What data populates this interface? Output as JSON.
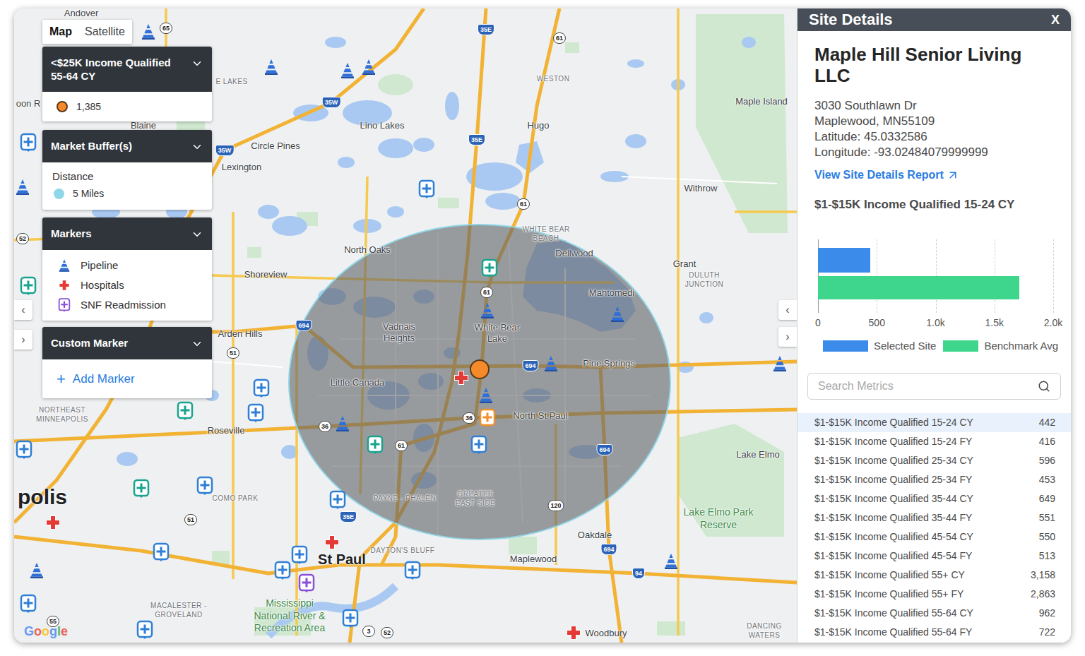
{
  "map_toggle": [
    {
      "label": "Map",
      "selected": true
    },
    {
      "label": "Satellite",
      "selected": false
    }
  ],
  "legend": {
    "metric_card": {
      "title": "<$25K Income Qualified 55-64 CY",
      "items": [
        {
          "value": "1,385",
          "color": "#f58a2b"
        }
      ]
    },
    "buffer_card": {
      "title": "Market Buffer(s)",
      "subtitle": "Distance",
      "items": [
        {
          "label": "5 Miles",
          "color": "#8fd6e6"
        }
      ]
    },
    "markers_card": {
      "title": "Markers",
      "items": [
        {
          "label": "Pipeline",
          "kind": "pipeline"
        },
        {
          "label": "Hospitals",
          "kind": "hospital"
        },
        {
          "label": "SNF Readmission",
          "kind": "snf",
          "color": "#8a4fd6"
        }
      ]
    },
    "custom_card": {
      "title": "Custom Marker",
      "action_icon": "+",
      "action": "Add Marker"
    }
  },
  "map": {
    "labels": [
      {
        "text": "Andover",
        "kind": "city"
      },
      {
        "text": "oon R",
        "kind": "city"
      },
      {
        "text": "Blaine",
        "kind": "city"
      },
      {
        "text": "E LAKES",
        "kind": "district"
      },
      {
        "text": "Lino Lakes",
        "kind": "city"
      },
      {
        "text": "Circle Pines",
        "kind": "city"
      },
      {
        "text": "Lexington",
        "kind": "city"
      },
      {
        "text": "WESTON",
        "kind": "district"
      },
      {
        "text": "Hugo",
        "kind": "city"
      },
      {
        "text": "Maple Island",
        "kind": "city"
      },
      {
        "text": "Withrow",
        "kind": "city"
      },
      {
        "text": "North Oaks",
        "kind": "city"
      },
      {
        "text": "WHITE BEAR BEACH",
        "kind": "district"
      },
      {
        "text": "Dellwood",
        "kind": "city"
      },
      {
        "text": "Grant",
        "kind": "city"
      },
      {
        "text": "DULUTH JUNCTION",
        "kind": "district"
      },
      {
        "text": "Mahtomedi",
        "kind": "city"
      },
      {
        "text": "Shoreview",
        "kind": "city"
      },
      {
        "text": "Vadnais Heights",
        "kind": "city"
      },
      {
        "text": "White Bear Lake",
        "kind": "city"
      },
      {
        "text": "Arden Hills",
        "kind": "city"
      },
      {
        "text": "Pine Springs",
        "kind": "city"
      },
      {
        "text": "Little Canada",
        "kind": "city"
      },
      {
        "text": "NORTHEAST MINNEAPOLIS",
        "kind": "district"
      },
      {
        "text": "Roseville",
        "kind": "city"
      },
      {
        "text": "North St Paul",
        "kind": "city"
      },
      {
        "text": "Lake Elmo",
        "kind": "city"
      },
      {
        "text": "polis",
        "kind": "big"
      },
      {
        "text": "COMO PARK",
        "kind": "district"
      },
      {
        "text": "PAYNE - PHALEN",
        "kind": "district"
      },
      {
        "text": "GREATER EAST SIDE",
        "kind": "district"
      },
      {
        "text": "Lake Elmo Park Reserve",
        "kind": "park"
      },
      {
        "text": "Oakdale",
        "kind": "city"
      },
      {
        "text": "DAYTON'S BLUFF",
        "kind": "district"
      },
      {
        "text": "St Paul",
        "kind": "capital"
      },
      {
        "text": "Maplewood",
        "kind": "city"
      },
      {
        "text": "MACALESTER - GROVELAND",
        "kind": "district"
      },
      {
        "text": "Mississippi National River & Recreation Area",
        "kind": "park"
      },
      {
        "text": "Woodbury",
        "kind": "city"
      },
      {
        "text": "DANCING WATERS",
        "kind": "district"
      }
    ],
    "shields": [
      {
        "text": "65",
        "kind": "route"
      },
      {
        "text": "35E",
        "kind": "interstate"
      },
      {
        "text": "61",
        "kind": "route"
      },
      {
        "text": "35W",
        "kind": "interstate"
      },
      {
        "text": "35E",
        "kind": "interstate"
      },
      {
        "text": "35W",
        "kind": "interstate"
      },
      {
        "text": "52",
        "kind": "route"
      },
      {
        "text": "61",
        "kind": "route"
      },
      {
        "text": "61",
        "kind": "route"
      },
      {
        "text": "694",
        "kind": "interstate"
      },
      {
        "text": "51",
        "kind": "route"
      },
      {
        "text": "694",
        "kind": "interstate"
      },
      {
        "text": "36",
        "kind": "route"
      },
      {
        "text": "36",
        "kind": "route"
      },
      {
        "text": "61",
        "kind": "route"
      },
      {
        "text": "694",
        "kind": "interstate"
      },
      {
        "text": "51",
        "kind": "route"
      },
      {
        "text": "120",
        "kind": "route"
      },
      {
        "text": "35E",
        "kind": "interstate"
      },
      {
        "text": "694",
        "kind": "interstate"
      },
      {
        "text": "94",
        "kind": "interstate"
      },
      {
        "text": "55",
        "kind": "route"
      },
      {
        "text": "3",
        "kind": "route"
      },
      {
        "text": "52",
        "kind": "route"
      }
    ],
    "markers": [
      {
        "kind": "pipeline"
      },
      {
        "kind": "pipeline"
      },
      {
        "kind": "pipeline"
      },
      {
        "kind": "pipeline"
      },
      {
        "kind": "pipeline"
      },
      {
        "kind": "pipeline"
      },
      {
        "kind": "pipeline"
      },
      {
        "kind": "pipeline"
      },
      {
        "kind": "pipeline"
      },
      {
        "kind": "pipeline"
      },
      {
        "kind": "pipeline"
      },
      {
        "kind": "pipeline"
      },
      {
        "kind": "pipeline"
      },
      {
        "kind": "hospital"
      },
      {
        "kind": "hospital"
      },
      {
        "kind": "hospital"
      },
      {
        "kind": "hospital"
      },
      {
        "kind": "snf",
        "color": "#2f7fd6"
      },
      {
        "kind": "snf",
        "color": "#2f7fd6"
      },
      {
        "kind": "snf",
        "color": "#19a38f"
      },
      {
        "kind": "snf",
        "color": "#19a38f"
      },
      {
        "kind": "snf",
        "color": "#2f7fd6"
      },
      {
        "kind": "snf",
        "color": "#2f7fd6"
      },
      {
        "kind": "snf",
        "color": "#19a38f"
      },
      {
        "kind": "snf",
        "color": "#19a38f"
      },
      {
        "kind": "snf",
        "color": "#2f7fd6"
      },
      {
        "kind": "snf",
        "color": "#19a38f"
      },
      {
        "kind": "snf",
        "color": "#2f7fd6"
      },
      {
        "kind": "snf",
        "color": "#f0902a"
      },
      {
        "kind": "snf",
        "color": "#2f7fd6"
      },
      {
        "kind": "snf",
        "color": "#2f7fd6"
      },
      {
        "kind": "snf",
        "color": "#2f7fd6"
      },
      {
        "kind": "snf",
        "color": "#2f7fd6"
      },
      {
        "kind": "snf",
        "color": "#2f7fd6"
      },
      {
        "kind": "snf",
        "color": "#8a4fd6"
      },
      {
        "kind": "snf",
        "color": "#2f7fd6"
      },
      {
        "kind": "snf",
        "color": "#2f7fd6"
      },
      {
        "kind": "snf",
        "color": "#2f7fd6"
      },
      {
        "kind": "snf",
        "color": "#2f7fd6"
      }
    ],
    "left_arrows": [
      "‹",
      "›"
    ],
    "right_arrows": [
      "‹",
      "›"
    ],
    "attribution": "Google"
  },
  "panel": {
    "header": "Site Details",
    "close": "X",
    "name": "Maple Hill Senior Living LLC",
    "address": [
      "3030 Southlawn Dr",
      "Maplewood, MN55109",
      "Latitude: 45.0332586",
      "Longitude: -93.02484079999999"
    ],
    "link": "View Site Details Report",
    "chart": {
      "title": "$1-$15K Income Qualified 15-24 CY",
      "axis_max": 2000,
      "ticks": [
        "0",
        "500",
        "1.0k",
        "1.5k",
        "2.0k"
      ],
      "series": [
        {
          "name": "Selected Site",
          "values": [
            442
          ],
          "color": "#3b8beb"
        },
        {
          "name": "Benchmark Avg",
          "values": [
            1710
          ],
          "color": "#3dd68c"
        }
      ]
    },
    "search": {
      "placeholder": "Search Metrics"
    },
    "metrics": [
      {
        "label": "$1-$15K Income Qualified 15-24 CY",
        "value": "442",
        "selected": true
      },
      {
        "label": "$1-$15K Income Qualified 15-24 FY",
        "value": "416",
        "selected": false
      },
      {
        "label": "$1-$15K Income Qualified 25-34 CY",
        "value": "596",
        "selected": false
      },
      {
        "label": "$1-$15K Income Qualified 25-34 FY",
        "value": "453",
        "selected": false
      },
      {
        "label": "$1-$15K Income Qualified 35-44 CY",
        "value": "649",
        "selected": false
      },
      {
        "label": "$1-$15K Income Qualified 35-44 FY",
        "value": "551",
        "selected": false
      },
      {
        "label": "$1-$15K Income Qualified 45-54 CY",
        "value": "550",
        "selected": false
      },
      {
        "label": "$1-$15K Income Qualified 45-54 FY",
        "value": "513",
        "selected": false
      },
      {
        "label": "$1-$15K Income Qualified 55+ CY",
        "value": "3,158",
        "selected": false
      },
      {
        "label": "$1-$15K Income Qualified 55+ FY",
        "value": "2,863",
        "selected": false
      },
      {
        "label": "$1-$15K Income Qualified 55-64 CY",
        "value": "962",
        "selected": false
      },
      {
        "label": "$1-$15K Income Qualified 55-64 FY",
        "value": "722",
        "selected": false
      }
    ]
  }
}
